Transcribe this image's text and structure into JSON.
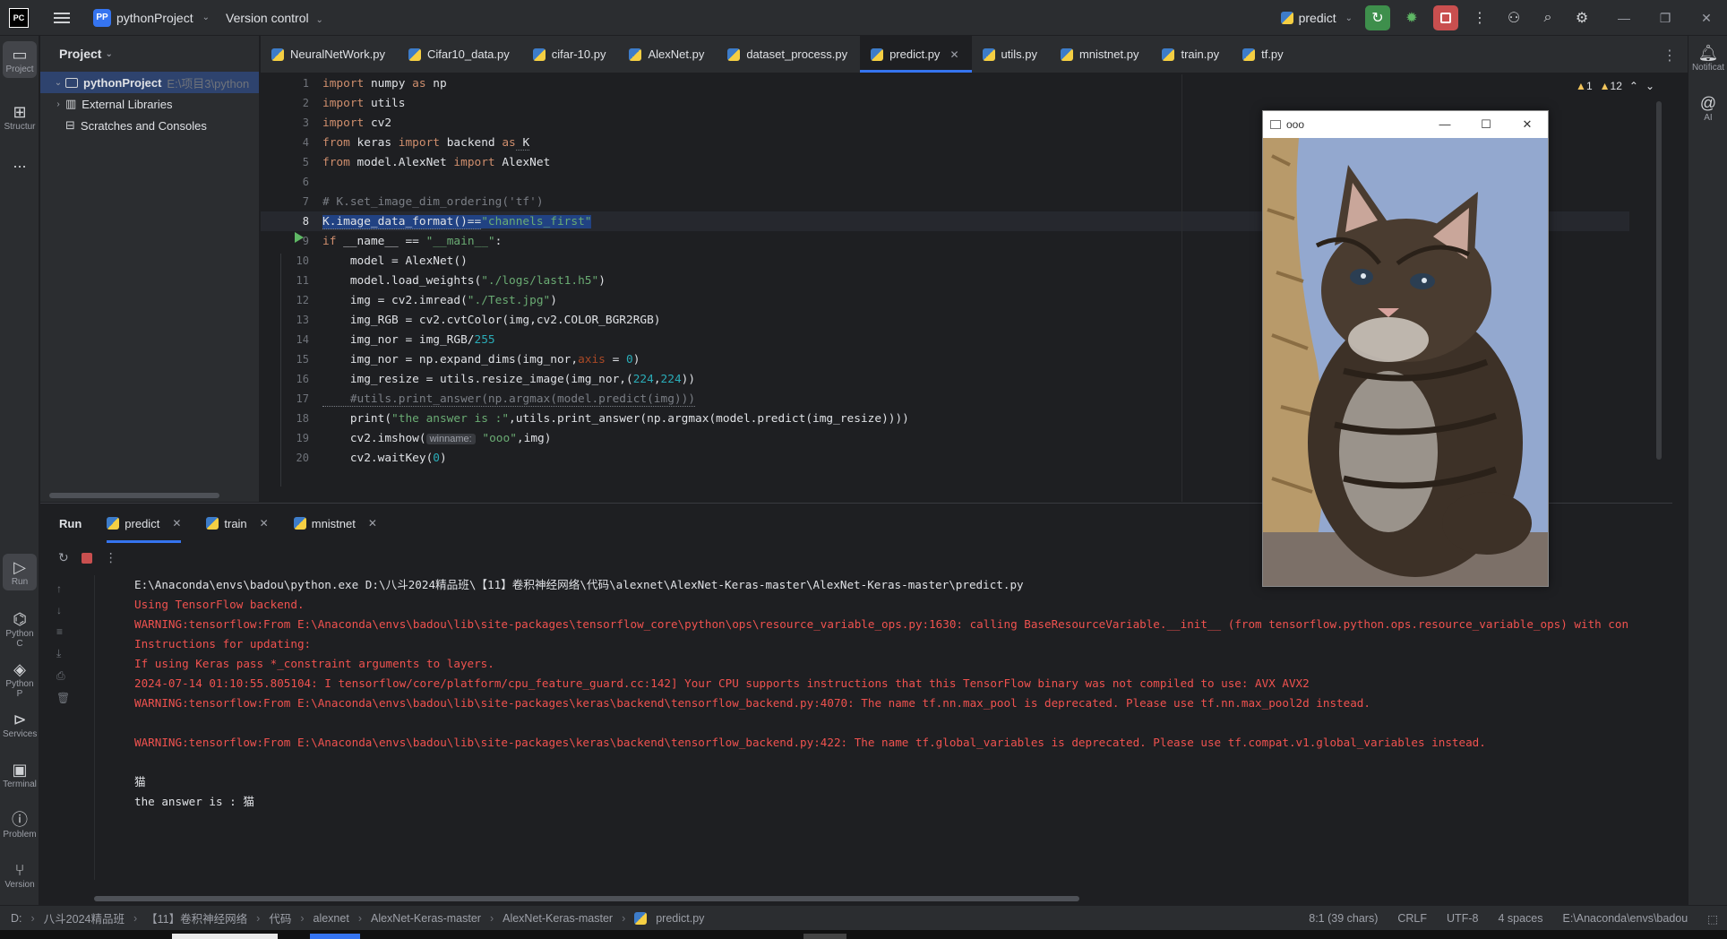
{
  "titlebar": {
    "logo": "PC",
    "project_badge": "PP",
    "project_name": "pythonProject",
    "version_control": "Version control",
    "run_config": "predict"
  },
  "left_tools": {
    "project": "Project",
    "structure": "Structur",
    "more": "...",
    "run": "Run",
    "python_console": "Python C",
    "python_packages": "Python P",
    "services": "Services",
    "terminal": "Terminal",
    "problems": "Problem",
    "version": "Version"
  },
  "right_tools": {
    "notifications": "Notificat",
    "ai": "AI"
  },
  "project_panel": {
    "title": "Project",
    "root_name": "pythonProject",
    "root_path": "E:\\项目3\\python",
    "external_libraries": "External Libraries",
    "scratches": "Scratches and Consoles"
  },
  "tabs": [
    {
      "label": "NeuralNetWork.py",
      "active": false
    },
    {
      "label": "Cifar10_data.py",
      "active": false
    },
    {
      "label": "cifar-10.py",
      "active": false
    },
    {
      "label": "AlexNet.py",
      "active": false
    },
    {
      "label": "dataset_process.py",
      "active": false
    },
    {
      "label": "predict.py",
      "active": true
    },
    {
      "label": "utils.py",
      "active": false
    },
    {
      "label": "mnistnet.py",
      "active": false
    },
    {
      "label": "train.py",
      "active": false
    },
    {
      "label": "tf.py",
      "active": false
    }
  ],
  "editor": {
    "warnings_a": "1",
    "warnings_b": "12",
    "line_numbers": [
      "1",
      "2",
      "3",
      "4",
      "5",
      "6",
      "7",
      "8",
      "9",
      "10",
      "11",
      "12",
      "13",
      "14",
      "15",
      "16",
      "17",
      "18",
      "19",
      "20"
    ],
    "inlay_hint": "winname:",
    "code": {
      "l1_kw": "import",
      "l1_rest": " numpy ",
      "l1_kw2": "as",
      "l1_rest2": " np",
      "l2_kw": "import",
      "l2_rest": " utils",
      "l3_kw": "import",
      "l3_rest": " cv2",
      "l4_kw": "from",
      "l4_rest": " keras ",
      "l4_kw2": "import",
      "l4_rest2": " backend ",
      "l4_kw3": "as",
      "l4_rest3": " K",
      "l5_kw": "from",
      "l5_rest": " model.AlexNet ",
      "l5_kw2": "import",
      "l5_rest2": " AlexNet",
      "l7_cm": "# K.set_image_dim_ordering('tf')",
      "l8_a": "K.image_data_format()==",
      "l8_str": "\"channels_first\"",
      "l9_kw": "if",
      "l9_rest": " __name__ == ",
      "l9_str": "\"__main__\"",
      "l9_end": ":",
      "l10": "    model = AlexNet()",
      "l11_a": "    model.load_weights(",
      "l11_str": "\"./logs/last1.h5\"",
      "l11_b": ")",
      "l12_a": "    img = cv2.imread(",
      "l12_str": "\"./Test.jpg\"",
      "l12_b": ")",
      "l13": "    img_RGB = cv2.cvtColor(img,cv2.COLOR_BGR2RGB)",
      "l14_a": "    img_nor = img_RGB/",
      "l14_num": "255",
      "l15_a": "    img_nor = np.expand_dims(img_nor,",
      "l15_prm": "axis",
      "l15_b": " = ",
      "l15_num": "0",
      "l15_c": ")",
      "l16_a": "    img_resize = utils.resize_image(img_nor,(",
      "l16_num1": "224",
      "l16_b": ",",
      "l16_num2": "224",
      "l16_c": "))",
      "l17_cm": "    #utils.print_answer(np.argmax(model.predict(img)))",
      "l18_a": "    print(",
      "l18_str": "\"the answer is :\"",
      "l18_b": ",utils.print_answer(np.argmax(model.predict(img_resize))))",
      "l19_a": "    cv2.imshow(",
      "l19_str": "\"ooo\"",
      "l19_b": ",img)",
      "l20_a": "    cv2.waitKey(",
      "l20_num": "0",
      "l20_b": ")"
    }
  },
  "image_window": {
    "title": "ooo",
    "content": "photo of a tabby kitten"
  },
  "run_panel": {
    "title": "Run",
    "tabs": [
      {
        "label": "predict",
        "active": true
      },
      {
        "label": "train",
        "active": false
      },
      {
        "label": "mnistnet",
        "active": false
      }
    ],
    "console": [
      {
        "text": "E:\\Anaconda\\envs\\badou\\python.exe D:\\八斗2024精品班\\【11】卷积神经网络\\代码\\alexnet\\AlexNet-Keras-master\\AlexNet-Keras-master\\predict.py",
        "type": "n"
      },
      {
        "text": "Using TensorFlow backend.",
        "type": "w"
      },
      {
        "text": "WARNING:tensorflow:From E:\\Anaconda\\envs\\badou\\lib\\site-packages\\tensorflow_core\\python\\ops\\resource_variable_ops.py:1630: calling BaseResourceVariable.__init__ (from tensorflow.python.ops.resource_variable_ops) with con",
        "type": "w"
      },
      {
        "text": "Instructions for updating:",
        "type": "w"
      },
      {
        "text": "If using Keras pass *_constraint arguments to layers.",
        "type": "w"
      },
      {
        "text": "2024-07-14 01:10:55.805104: I tensorflow/core/platform/cpu_feature_guard.cc:142] Your CPU supports instructions that this TensorFlow binary was not compiled to use: AVX AVX2",
        "type": "w"
      },
      {
        "text": "WARNING:tensorflow:From E:\\Anaconda\\envs\\badou\\lib\\site-packages\\keras\\backend\\tensorflow_backend.py:4070: The name tf.nn.max_pool is deprecated. Please use tf.nn.max_pool2d instead.",
        "type": "w"
      },
      {
        "text": "",
        "type": "n"
      },
      {
        "text": "WARNING:tensorflow:From E:\\Anaconda\\envs\\badou\\lib\\site-packages\\keras\\backend\\tensorflow_backend.py:422: The name tf.global_variables is deprecated. Please use tf.compat.v1.global_variables instead.",
        "type": "w"
      },
      {
        "text": "",
        "type": "n"
      },
      {
        "text": "猫",
        "type": "n"
      },
      {
        "text": "the answer is : 猫",
        "type": "n"
      }
    ]
  },
  "statusbar": {
    "crumbs": [
      "D:",
      "八斗2024精品班",
      "【11】卷积神经网络",
      "代码",
      "alexnet",
      "AlexNet-Keras-master",
      "AlexNet-Keras-master",
      "predict.py"
    ],
    "position": "8:1 (39 chars)",
    "line_sep": "CRLF",
    "encoding": "UTF-8",
    "indent": "4 spaces",
    "interpreter": "E:\\Anaconda\\envs\\badou"
  }
}
